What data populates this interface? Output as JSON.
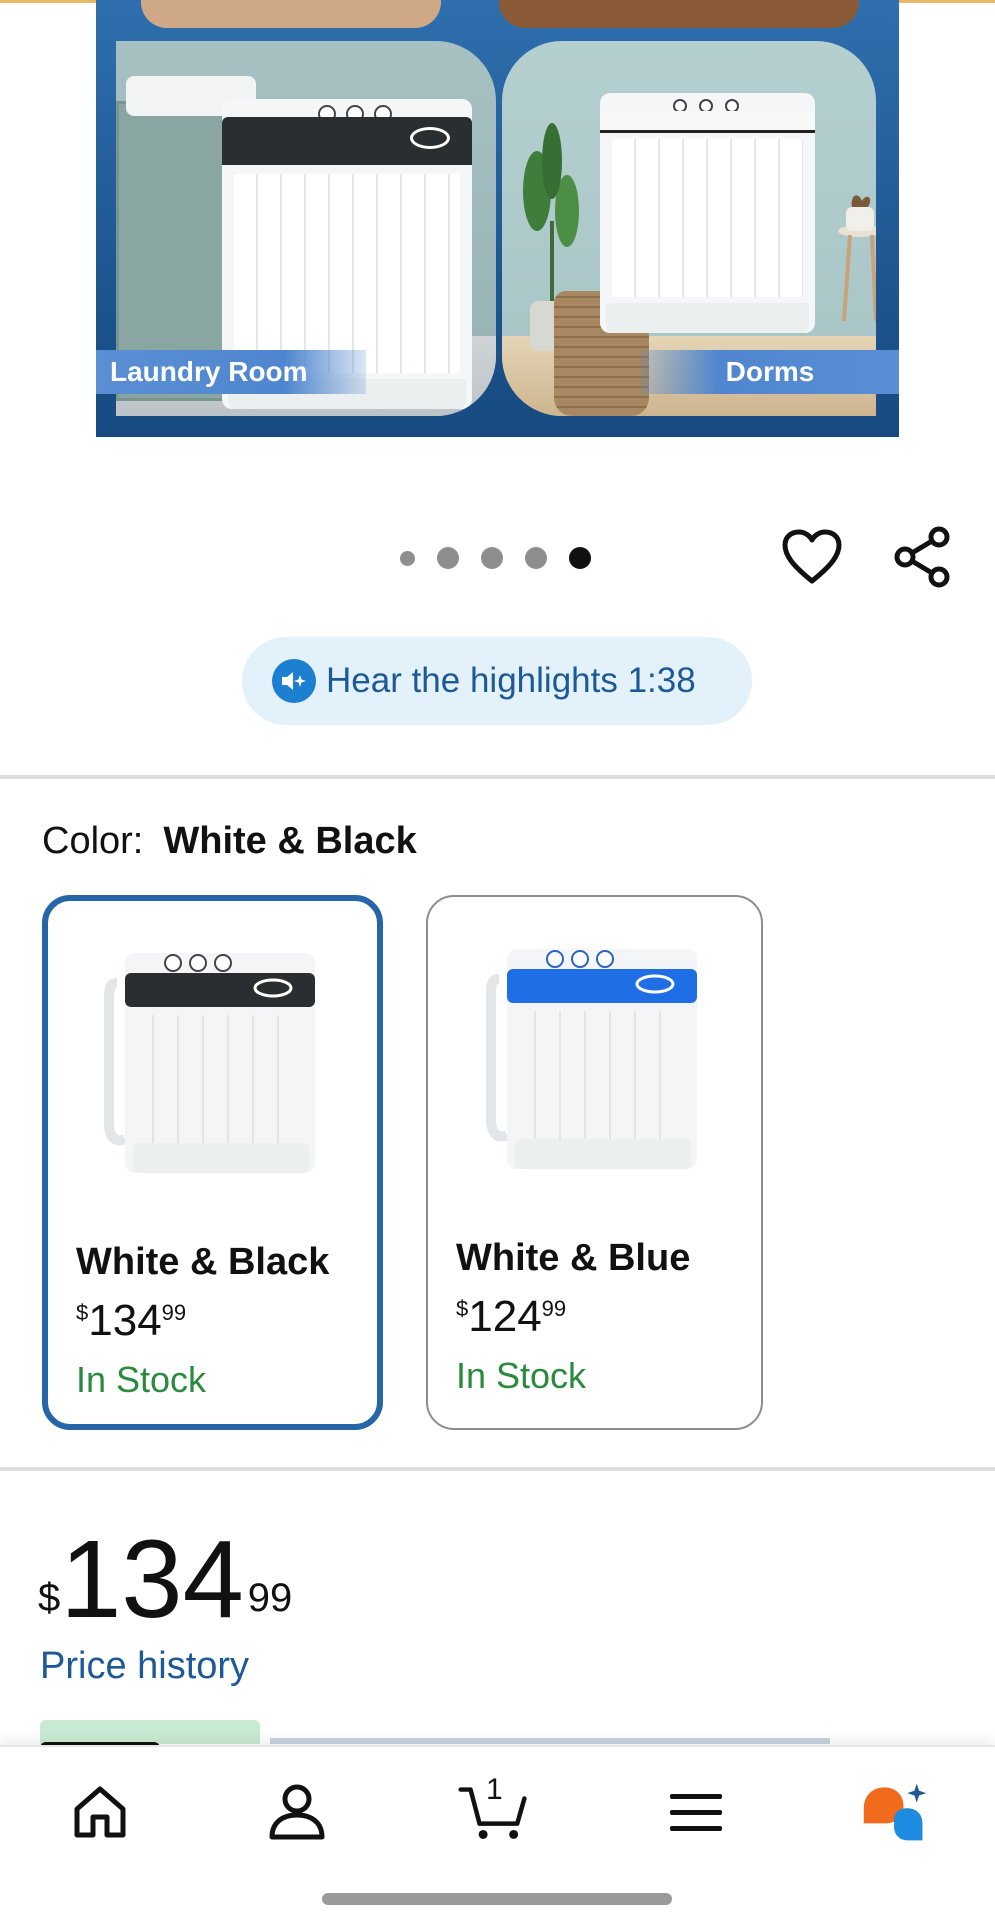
{
  "hero": {
    "captions": [
      "Laundry Room",
      "Dorms"
    ],
    "carousel": {
      "total": 5,
      "active_index": 4
    }
  },
  "actions": {
    "favorite_icon": "heart-outline-icon",
    "share_icon": "share-icon"
  },
  "highlights": {
    "label": "Hear the highlights 1:38",
    "icon": "speaker-sparkle-icon"
  },
  "color": {
    "label": "Color:",
    "selected": "White & Black",
    "options": [
      {
        "name": "White & Black",
        "price_dollar": "$",
        "price_whole": "134",
        "price_cents": "99",
        "stock": "In Stock",
        "lid_color": "#2b2e31",
        "selected": true
      },
      {
        "name": "White & Blue",
        "price_dollar": "$",
        "price_whole": "124",
        "price_cents": "99",
        "stock": "In Stock",
        "lid_color": "#1f6ee5",
        "selected": false
      }
    ]
  },
  "price": {
    "currency": "$",
    "whole": "134",
    "cents": "99",
    "history_link": "Price history"
  },
  "bottom_nav": {
    "items": [
      {
        "icon": "home-icon"
      },
      {
        "icon": "account-icon"
      },
      {
        "icon": "cart-icon",
        "count": "1"
      },
      {
        "icon": "menu-icon"
      },
      {
        "icon": "assistant-icon"
      }
    ]
  },
  "colors": {
    "accent_blue": "#2666a8",
    "link_blue": "#1d5996",
    "in_stock_green": "#2a8a3e",
    "highlight_bg": "#e3f1fb"
  }
}
